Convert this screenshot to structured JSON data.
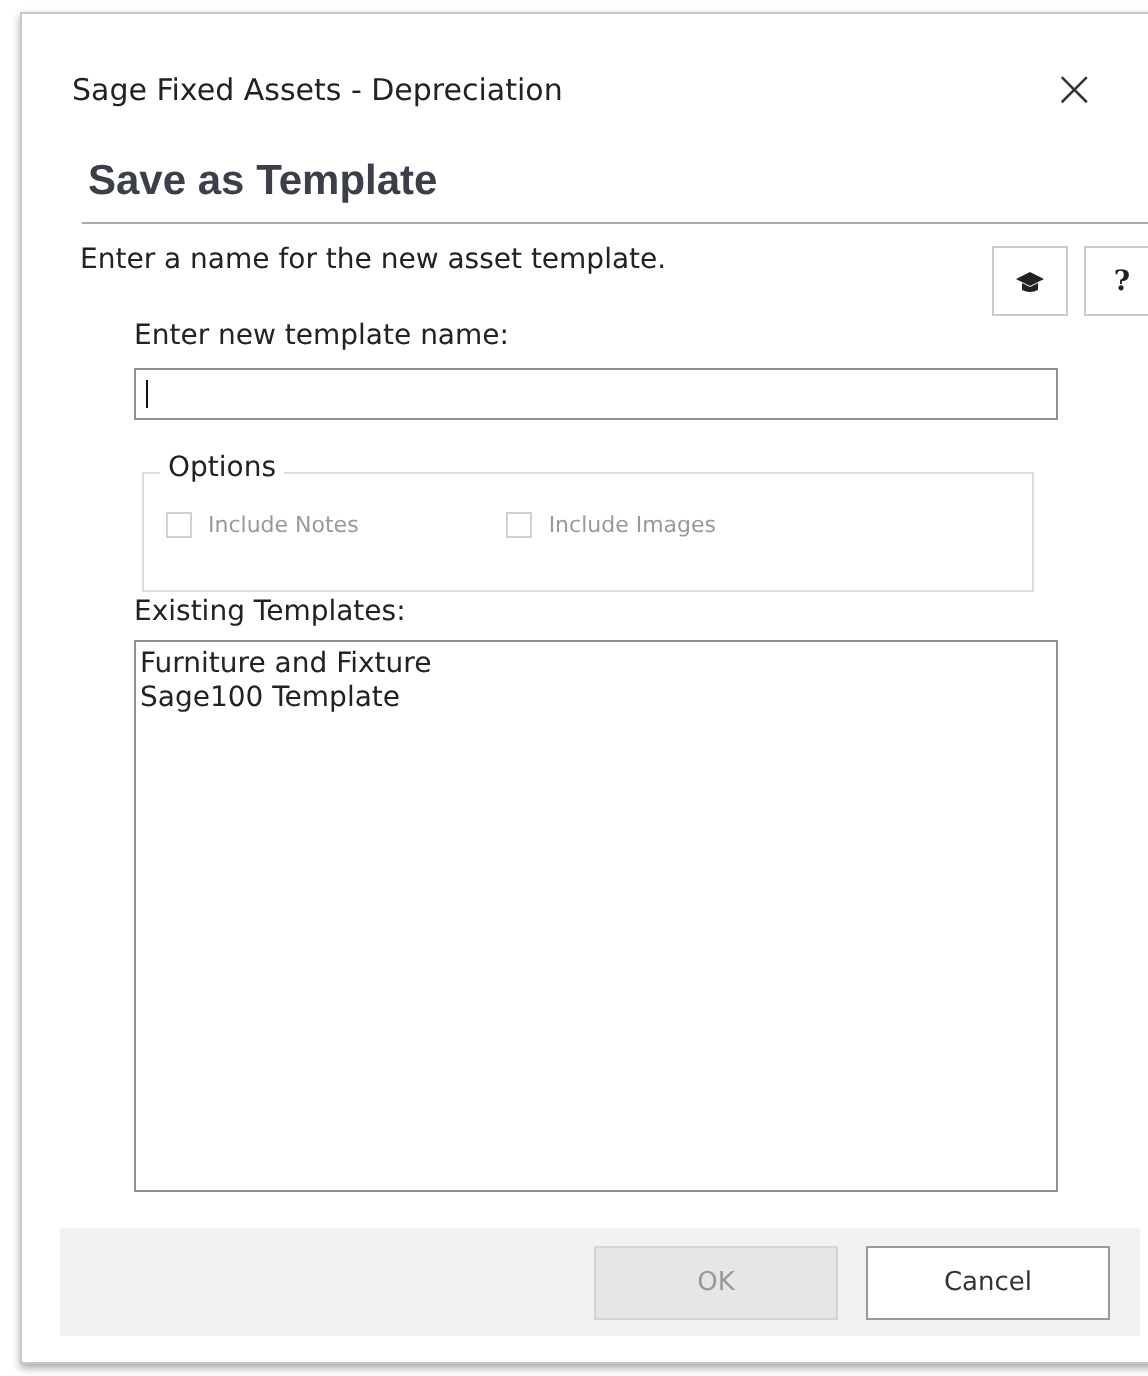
{
  "window": {
    "title": "Sage Fixed Assets - Depreciation",
    "close": "×"
  },
  "heading": "Save as Template",
  "description": "Enter a name for the new asset template.",
  "help_button": "?",
  "name_field": {
    "label": "Enter new template name:",
    "focused": true
  },
  "options": {
    "legend": "Options",
    "items": [
      {
        "label": "Include Notes",
        "checked": false,
        "disabled": true
      },
      {
        "label": "Include Images",
        "checked": false,
        "disabled": true
      }
    ]
  },
  "existing": {
    "label": "Existing Templates:",
    "items": [
      {
        "label": "Furniture and Fixture",
        "selected": false
      },
      {
        "label": "Sage100 Template",
        "selected": false
      }
    ]
  },
  "buttons": [
    {
      "label": "OK",
      "disabled": true
    },
    {
      "label": "Cancel",
      "disabled": false
    }
  ]
}
